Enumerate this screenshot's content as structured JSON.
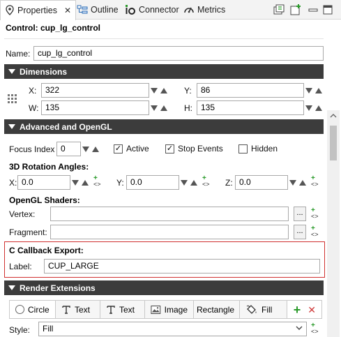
{
  "tabs": [
    {
      "label": "Properties",
      "icon": "pin-icon",
      "active": true
    },
    {
      "label": "Outline",
      "icon": "outline-icon"
    },
    {
      "label": "Connector",
      "icon": "connector-icon"
    },
    {
      "label": "Metrics",
      "icon": "gauge-icon"
    }
  ],
  "close_glyph": "✕",
  "header": {
    "title": "Control: cup_lg_control"
  },
  "name": {
    "label": "Name:",
    "value": "cup_lg_control"
  },
  "dimensions": {
    "section": "Dimensions",
    "x_label": "X:",
    "x": "322",
    "y_label": "Y:",
    "y": "86",
    "w_label": "W:",
    "w": "135",
    "h_label": "H:",
    "h": "135"
  },
  "advanced": {
    "section": "Advanced and OpenGL",
    "focus_label": "Focus Index",
    "focus_value": "0",
    "active_label": "Active",
    "active_checked": true,
    "stop_label": "Stop Events",
    "stop_checked": true,
    "hidden_label": "Hidden",
    "hidden_checked": false,
    "rotation_heading": "3D Rotation Angles:",
    "rx_label": "X:",
    "rx": "0.0",
    "ry_label": "Y:",
    "ry": "0.0",
    "rz_label": "Z:",
    "rz": "0.0",
    "shaders_heading": "OpenGL Shaders:",
    "vertex_label": "Vertex:",
    "vertex_value": "",
    "fragment_label": "Fragment:",
    "fragment_value": "",
    "browse_label": "..."
  },
  "callback": {
    "heading": "C Callback Export:",
    "label": "Label:",
    "value": "CUP_LARGE"
  },
  "render": {
    "section": "Render Extensions",
    "tabs": [
      {
        "label": "Circle",
        "icon": "radio-icon",
        "active": true
      },
      {
        "label": "Text",
        "icon": "text-icon"
      },
      {
        "label": "Text",
        "icon": "text-icon"
      },
      {
        "label": "Image",
        "icon": "image-icon"
      },
      {
        "label": "Rectangle",
        "icon": ""
      },
      {
        "label": "Fill",
        "icon": "paint-bucket-icon"
      }
    ],
    "add_glyph": "+",
    "remove_glyph": "✕",
    "style_label": "Style:",
    "style_value": "Fill"
  },
  "colors": {
    "section_bg": "#3c3c3c",
    "callout_border": "#d0302f",
    "add_green": "#2a9a2a",
    "remove_red": "#d03a3a"
  }
}
